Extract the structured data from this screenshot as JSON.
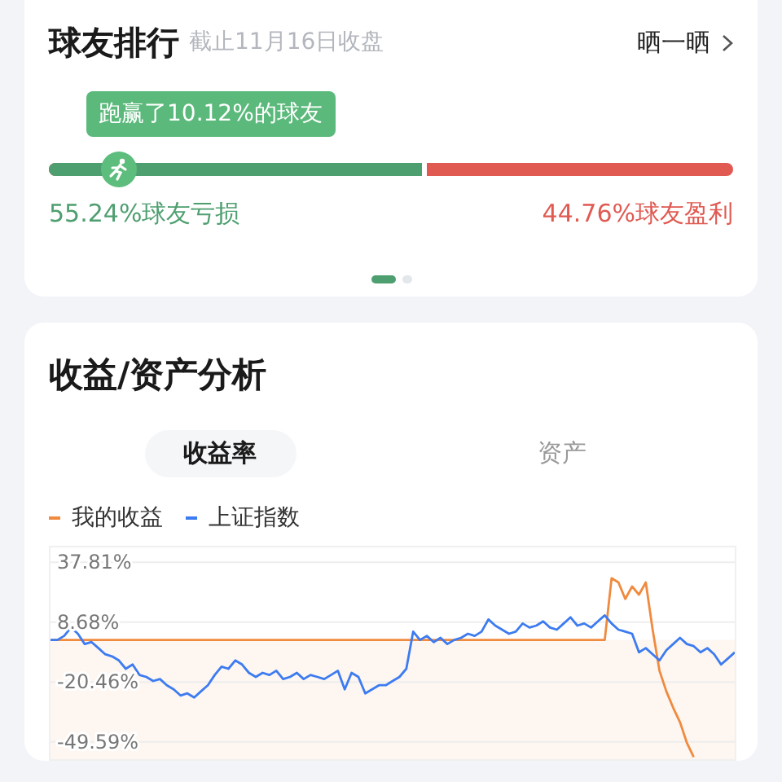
{
  "ranking": {
    "title": "球友排行",
    "subtitle": "截止11月16日收盘",
    "share_button": "晒一晒",
    "tooltip": "跑赢了10.12%的球友",
    "bar": {
      "level": 0.5524
    },
    "marker": {
      "level": 0.1012
    },
    "loss_label": "55.24%球友亏损",
    "profit_label": "44.76%球友盈利",
    "pages": [
      {
        "selected": true
      },
      {
        "selected": false
      }
    ]
  },
  "analysis": {
    "title": "收益/资产分析",
    "tabs": [
      {
        "label": "收益率",
        "selected": true
      },
      {
        "label": "资产",
        "selected": false
      }
    ],
    "chart_data": {
      "type": "line",
      "ylim": [
        -58,
        45
      ],
      "grid": true,
      "yticks": [
        {
          "value": 37.81,
          "label": "37.81%"
        },
        {
          "value": 8.68,
          "label": "8.68%"
        },
        {
          "value": -20.46,
          "label": "-20.46%"
        },
        {
          "value": -49.59,
          "label": "-49.59%"
        }
      ],
      "categories": [
        null,
        null,
        null,
        null,
        null,
        null,
        null,
        null,
        null,
        null,
        null,
        null,
        null,
        null,
        null,
        null,
        null,
        null,
        null,
        null,
        null,
        null,
        null,
        null,
        null,
        null,
        null,
        null,
        null,
        null,
        null,
        null,
        null,
        null,
        null,
        null,
        null,
        null,
        null,
        null,
        null,
        null,
        null,
        null,
        null,
        null,
        null,
        null,
        null,
        null,
        null,
        null,
        null,
        null,
        null,
        null,
        null,
        null,
        null,
        null,
        null,
        null,
        null,
        null,
        null,
        null,
        null,
        null,
        null,
        null,
        null,
        null,
        null,
        null,
        null,
        null,
        null,
        null,
        null,
        null,
        null,
        null,
        null,
        null,
        null,
        null,
        null,
        null,
        null,
        null,
        null,
        null,
        null,
        null,
        null,
        null,
        null,
        null,
        null,
        null,
        null
      ],
      "series": [
        {
          "name": "我的收益",
          "color": "#f08a3e",
          "values": [
            0,
            0,
            0,
            0,
            0,
            0,
            0,
            0,
            0,
            0,
            0,
            0,
            0,
            0,
            0,
            0,
            0,
            0,
            0,
            0,
            0,
            0,
            0,
            0,
            0,
            0,
            0,
            0,
            0,
            0,
            0,
            0,
            0,
            0,
            0,
            0,
            0,
            0,
            0,
            0,
            0,
            0,
            0,
            0,
            0,
            0,
            0,
            0,
            0,
            0,
            0,
            0,
            0,
            0,
            0,
            0,
            0,
            0,
            0,
            0,
            0,
            0,
            0,
            0,
            0,
            0,
            0,
            0,
            0,
            0,
            0,
            0,
            0,
            0,
            0,
            0,
            0,
            0,
            0,
            0,
            0,
            0,
            30,
            28,
            20,
            26,
            22,
            28,
            5,
            -15,
            -25,
            -33,
            -40,
            -50,
            -57,
            null,
            null,
            null,
            null,
            null,
            null
          ]
        },
        {
          "name": "上证指数",
          "color": "#3d7bf0",
          "values": [
            0,
            0,
            2,
            6,
            3,
            -2,
            -1,
            -4,
            -7,
            -8,
            -10,
            -14,
            -12,
            -17,
            -18,
            -20,
            -19,
            -22,
            -24,
            -27,
            -26,
            -28,
            -25,
            -22,
            -17,
            -13,
            -14,
            -10,
            -12,
            -16,
            -18,
            -16,
            -17,
            -15,
            -19,
            -18,
            -16,
            -19,
            -17,
            -18,
            -19,
            -17,
            -15,
            -24,
            -16,
            -18,
            -26,
            -24,
            -22,
            -22,
            -20,
            -18,
            -14,
            4,
            0,
            2,
            -1,
            1,
            -2,
            0,
            1,
            3,
            2,
            4,
            10,
            7,
            5,
            3,
            4,
            8,
            6,
            7,
            9,
            6,
            5,
            8,
            11,
            7,
            8,
            6,
            9,
            12,
            8,
            5,
            4,
            3,
            -6,
            -4,
            -7,
            -10,
            -5,
            -2,
            1,
            -2,
            -3,
            -6,
            -4,
            -7,
            -12,
            -9,
            -6
          ]
        }
      ]
    }
  }
}
